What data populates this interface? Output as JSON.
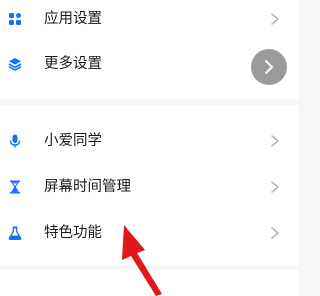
{
  "settings": {
    "top_group": [
      {
        "label": "应用设置",
        "icon": "apps-grid-icon"
      },
      {
        "label": "更多设置",
        "icon": "layers-icon"
      }
    ],
    "bottom_group": [
      {
        "label": "小爱同学",
        "icon": "microphone-icon"
      },
      {
        "label": "屏幕时间管理",
        "icon": "hourglass-icon"
      },
      {
        "label": "特色功能",
        "icon": "flask-icon"
      }
    ]
  },
  "colors": {
    "background": "#f6f6f6",
    "card": "#ffffff",
    "icon_blue": "#1a6dff",
    "chevron": "#b8b8b8",
    "floating_button": "#9a9a9a",
    "arrow_red": "#e01818"
  }
}
